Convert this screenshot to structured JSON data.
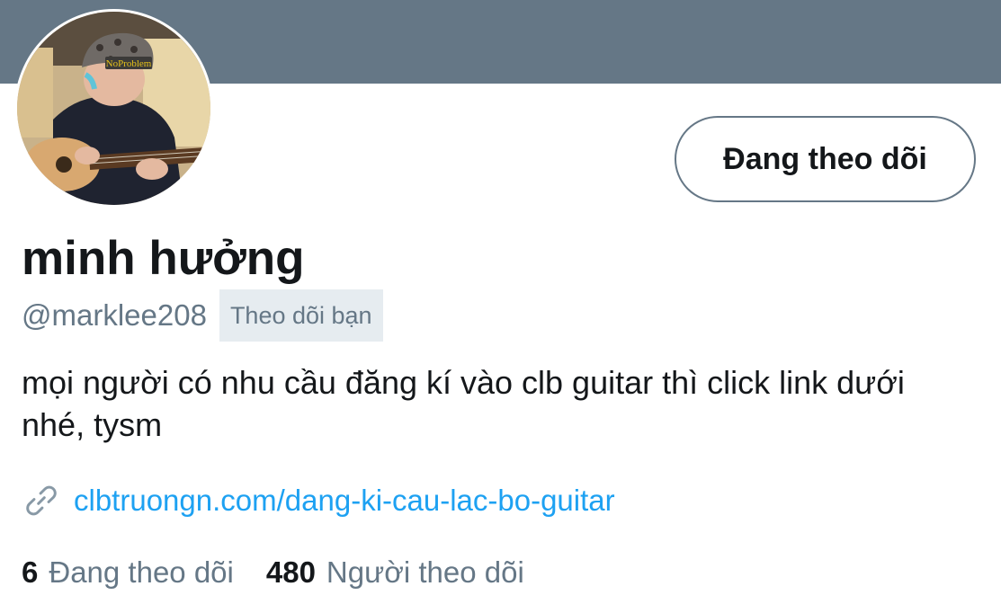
{
  "profile": {
    "display_name": "minh hưởng",
    "handle": "@marklee208",
    "follows_you_label": "Theo dõi bạn",
    "bio": "mọi người có nhu cầu đăng kí vào clb guitar thì click link dưới nhé, tysm",
    "link": "clbtruongn.com/dang-ki-cau-lac-bo-guitar"
  },
  "actions": {
    "following_button": "Đang theo dõi"
  },
  "stats": {
    "following_count": "6",
    "following_label": "Đang theo dõi",
    "followers_count": "480",
    "followers_label": "Người theo dõi"
  },
  "avatar": {
    "cap_text": "NoProblem"
  },
  "colors": {
    "banner": "#657786",
    "text_primary": "#14171a",
    "text_secondary": "#657786",
    "link": "#1da1f2",
    "badge_bg": "#e6ecf0"
  }
}
